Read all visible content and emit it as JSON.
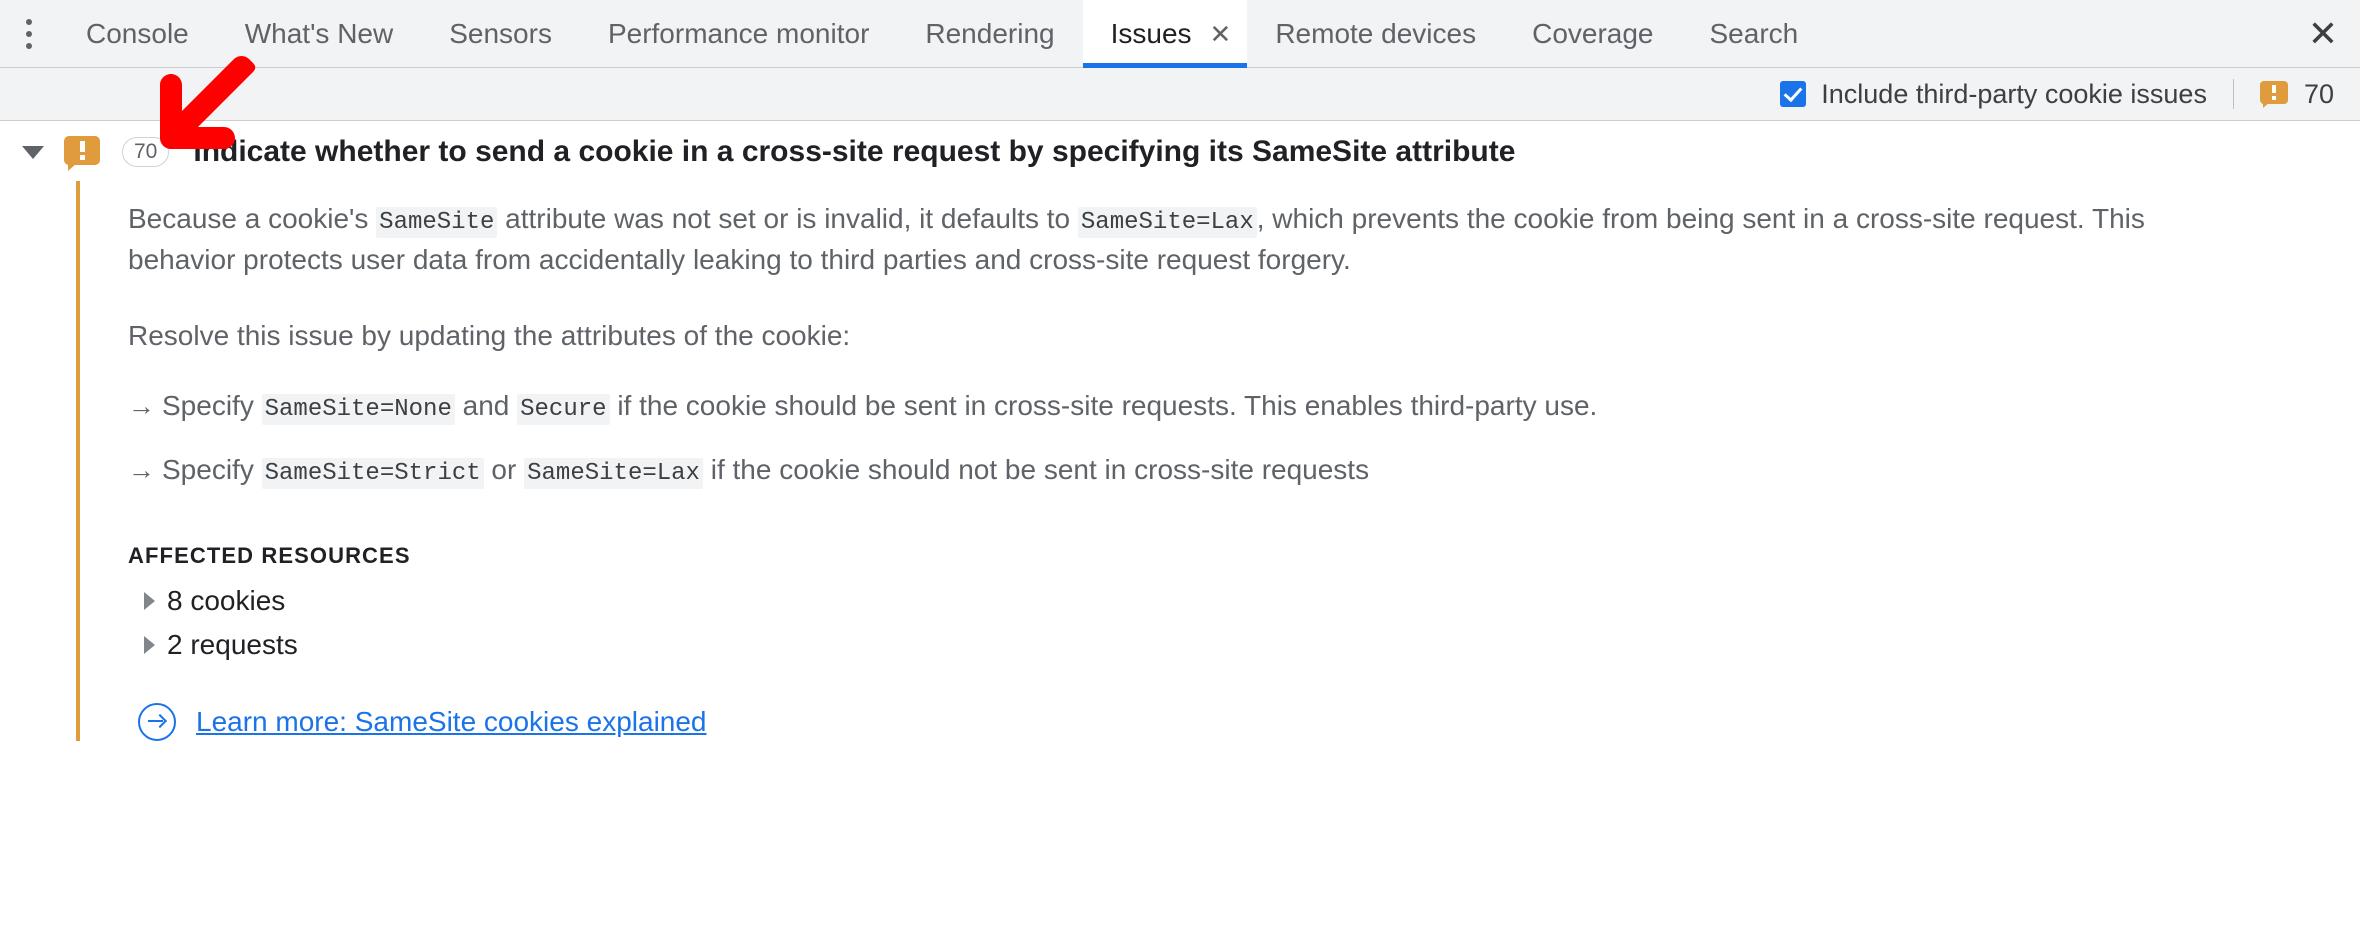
{
  "tabbar": {
    "more_icon": "kebab-menu-icon",
    "tabs": [
      {
        "label": "Console",
        "active": false
      },
      {
        "label": "What's New",
        "active": false
      },
      {
        "label": "Sensors",
        "active": false
      },
      {
        "label": "Performance monitor",
        "active": false
      },
      {
        "label": "Rendering",
        "active": false
      },
      {
        "label": "Issues",
        "active": true
      },
      {
        "label": "Remote devices",
        "active": false
      },
      {
        "label": "Coverage",
        "active": false
      },
      {
        "label": "Search",
        "active": false
      }
    ],
    "active_tab_close": "✕",
    "panel_close": "✕",
    "accent_color": "#1a73e8"
  },
  "toolbar": {
    "third_party_checkbox_label": "Include third-party cookie issues",
    "third_party_checkbox_checked": true,
    "issue_count": "70",
    "warning_color": "#e09b3d"
  },
  "issue": {
    "expanded": true,
    "count_badge": "70",
    "title": "Indicate whether to send a cookie in a cross-site request by specifying its SameSite attribute",
    "paragraph_1": {
      "part_1": "Because a cookie's ",
      "code_1": "SameSite",
      "part_2": " attribute was not set or is invalid, it defaults to ",
      "code_2": "SameSite=Lax",
      "part_3": ", which prevents the cookie from being sent in a cross-site request. This behavior protects user data from accidentally leaking to third parties and cross-site request forgery."
    },
    "paragraph_2": "Resolve this issue by updating the attributes of the cookie:",
    "bullets": [
      {
        "arrow": "→",
        "part_1": "Specify ",
        "code_1": "SameSite=None",
        "part_2": " and ",
        "code_2": "Secure",
        "part_3": " if the cookie should be sent in cross-site requests. This enables third-party use."
      },
      {
        "arrow": "→",
        "part_1": "Specify ",
        "code_1": "SameSite=Strict",
        "part_2": " or ",
        "code_2": "SameSite=Lax",
        "part_3": " if the cookie should not be sent in cross-site requests"
      }
    ],
    "affected_resources_label": "AFFECTED RESOURCES",
    "resources": [
      {
        "label": "8 cookies"
      },
      {
        "label": "2 requests"
      }
    ],
    "learn_more_link": "Learn more: SameSite cookies explained",
    "link_color": "#1a73e8",
    "left_border_color": "#e09b3d"
  },
  "annotation": {
    "arrow_color": "#ff0000",
    "direction": "down-left"
  }
}
